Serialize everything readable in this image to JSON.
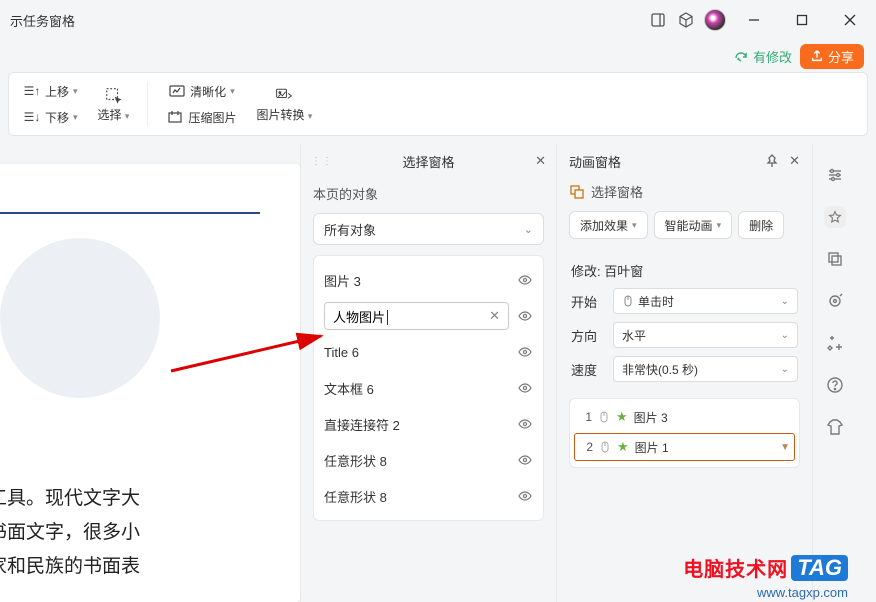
{
  "titlebar": {
    "task_pane": "示任务窗格"
  },
  "status": {
    "has_changes": "有修改",
    "share": "分享"
  },
  "ribbon": {
    "move_up": "上移",
    "move_down": "下移",
    "select": "选择",
    "clarity": "清晰化",
    "compress": "压缩图片",
    "convert": "图片转换"
  },
  "sel_panel": {
    "title": "选择窗格",
    "sub": "本页的对象",
    "filter": "所有对象",
    "items": [
      "图片 3",
      "Title 6",
      "文本框 6",
      "直接连接符 2",
      "任意形状 8",
      "任意形状 8"
    ],
    "editing": "人物图片"
  },
  "anim_panel": {
    "title": "动画窗格",
    "select_pane": "选择窗格",
    "add_effect": "添加效果",
    "smart_anim": "智能动画",
    "delete": "删除",
    "modify": "修改: 百叶窗",
    "start_lbl": "开始",
    "start_val": "单击时",
    "dir_lbl": "方向",
    "dir_val": "水平",
    "speed_lbl": "速度",
    "speed_val": "非常快(0.5 秒)",
    "list": [
      {
        "idx": "1",
        "name": "图片 3"
      },
      {
        "idx": "2",
        "name": "图片 1"
      }
    ]
  },
  "slide": {
    "body": "式和工具。现代文字大\n产生书面文字，很多小\n了国家和民族的书面表"
  },
  "watermark": {
    "cn": "电脑技术网",
    "tag": "TAG",
    "url": "www.tagxp.com"
  }
}
